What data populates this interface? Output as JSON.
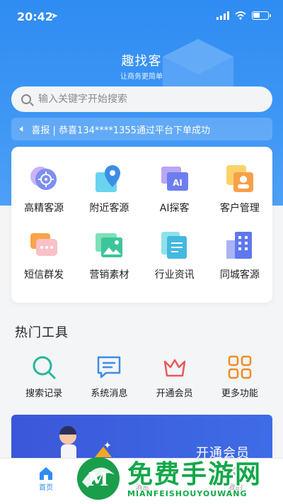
{
  "status_bar": {
    "time": "20:42",
    "location_icon": "location-arrow-icon"
  },
  "header": {
    "title": "趣找客",
    "subtitle": "让商务更简单"
  },
  "search": {
    "placeholder": "输入关键字开始搜索"
  },
  "notice": {
    "text": "喜报 | 恭喜134****1355通过平台下单成功"
  },
  "grid": {
    "items": [
      {
        "label": "高精客源",
        "icon": "target-icon"
      },
      {
        "label": "附近客源",
        "icon": "map-pin-icon"
      },
      {
        "label": "AI探客",
        "icon": "ai-icon"
      },
      {
        "label": "客户管理",
        "icon": "contact-card-icon"
      },
      {
        "label": "短信群发",
        "icon": "chat-bubble-icon"
      },
      {
        "label": "营销素材",
        "icon": "image-icon"
      },
      {
        "label": "行业资讯",
        "icon": "document-icon"
      },
      {
        "label": "同城客源",
        "icon": "building-icon"
      }
    ]
  },
  "hot_tools": {
    "title": "热门工具",
    "items": [
      {
        "label": "搜索记录",
        "icon": "search-icon",
        "color": "#26b89a"
      },
      {
        "label": "系统消息",
        "icon": "message-icon",
        "color": "#3a8ee6"
      },
      {
        "label": "开通会员",
        "icon": "crown-icon",
        "color": "#e8585a"
      },
      {
        "label": "更多功能",
        "icon": "grid-icon",
        "color": "#f08a24"
      }
    ]
  },
  "banner": {
    "text": "开通会员"
  },
  "tabbar": {
    "home": "首页",
    "message": "消息",
    "mine": "我的"
  },
  "watermark": {
    "text": "免费手游网",
    "sub": "MIANFEISHOUYOUWANG"
  },
  "colors": {
    "primary": "#2f8cf2",
    "watermark": "#12a84a"
  }
}
